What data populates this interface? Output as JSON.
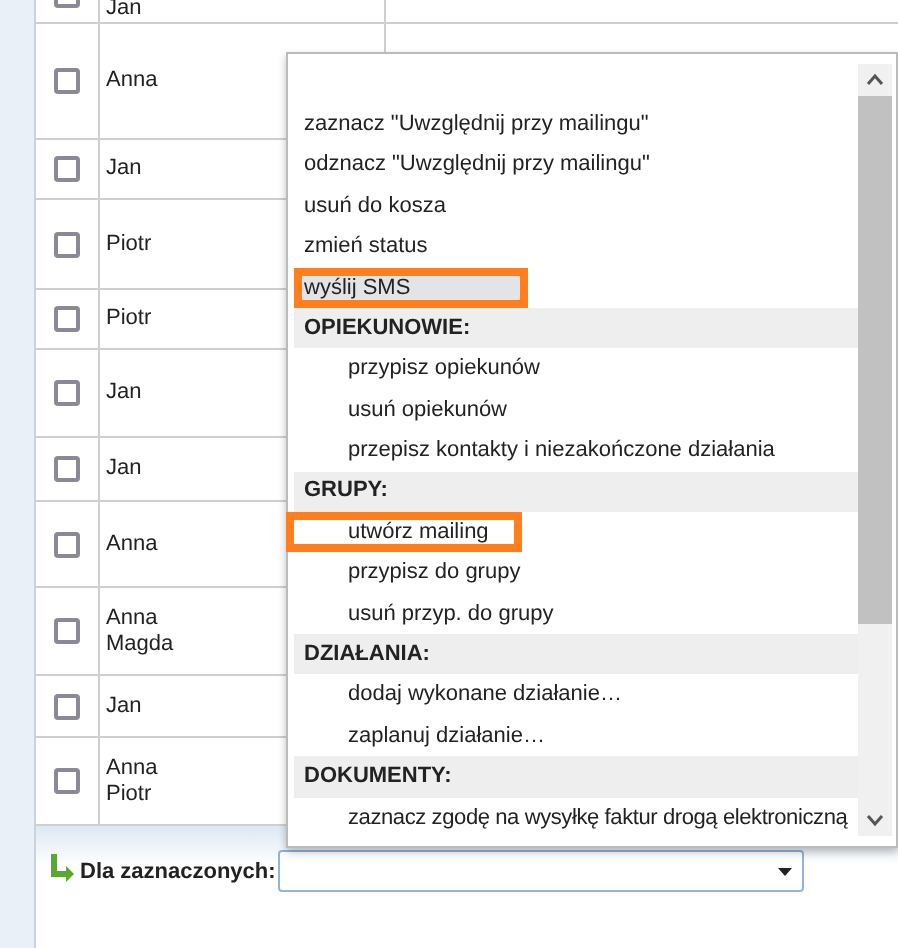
{
  "table": {
    "rows": [
      {
        "checked": false,
        "names": [
          "Jan"
        ],
        "partial": true
      },
      {
        "checked": false,
        "names": [
          "Anna"
        ]
      },
      {
        "checked": false,
        "names": [
          "Jan"
        ]
      },
      {
        "checked": false,
        "names": [
          "Piotr"
        ]
      },
      {
        "checked": false,
        "names": [
          "Piotr"
        ]
      },
      {
        "checked": false,
        "names": [
          "Jan"
        ]
      },
      {
        "checked": false,
        "names": [
          "Jan"
        ]
      },
      {
        "checked": false,
        "names": [
          "Anna"
        ]
      },
      {
        "checked": false,
        "names": [
          "Anna",
          "Magda"
        ]
      },
      {
        "checked": false,
        "names": [
          "Jan"
        ]
      },
      {
        "checked": false,
        "names": [
          "Anna",
          "Piotr"
        ]
      }
    ]
  },
  "bulk_action": {
    "label": "Dla zaznaczonych:"
  },
  "dropdown": {
    "items": [
      {
        "kind": "option",
        "label": "zaznacz \"Uwzględnij przy mailingu\"",
        "selected": false,
        "annotated": false
      },
      {
        "kind": "option",
        "label": "odznacz \"Uwzględnij przy mailingu\"",
        "selected": false,
        "annotated": false
      },
      {
        "kind": "option",
        "label": "usuń do kosza",
        "selected": false,
        "annotated": false
      },
      {
        "kind": "option",
        "label": "zmień status",
        "selected": false,
        "annotated": false
      },
      {
        "kind": "option",
        "label": "wyślij SMS",
        "selected": true,
        "annotated": true
      },
      {
        "kind": "group",
        "label": "OPIEKUNOWIE:"
      },
      {
        "kind": "suboption",
        "label": "przypisz opiekunów",
        "selected": false,
        "annotated": false
      },
      {
        "kind": "suboption",
        "label": "usuń opiekunów",
        "selected": false,
        "annotated": false
      },
      {
        "kind": "suboption",
        "label": "przepisz kontakty i niezakończone działania",
        "selected": false,
        "annotated": false
      },
      {
        "kind": "group",
        "label": "GRUPY:"
      },
      {
        "kind": "suboption",
        "label": "utwórz mailing",
        "selected": false,
        "annotated": true
      },
      {
        "kind": "suboption",
        "label": "przypisz do grupy",
        "selected": false,
        "annotated": false
      },
      {
        "kind": "suboption",
        "label": "usuń przyp. do grupy",
        "selected": false,
        "annotated": false
      },
      {
        "kind": "group",
        "label": "DZIAŁANIA:"
      },
      {
        "kind": "suboption",
        "label": "dodaj wykonane działanie…",
        "selected": false,
        "annotated": false
      },
      {
        "kind": "suboption",
        "label": "zaplanuj działanie…",
        "selected": false,
        "annotated": false
      },
      {
        "kind": "group",
        "label": "DOKUMENTY:"
      },
      {
        "kind": "suboption",
        "label": "zaznacz zgodę na wysyłkę faktur drogą elektroniczną",
        "selected": false,
        "annotated": false
      }
    ]
  }
}
